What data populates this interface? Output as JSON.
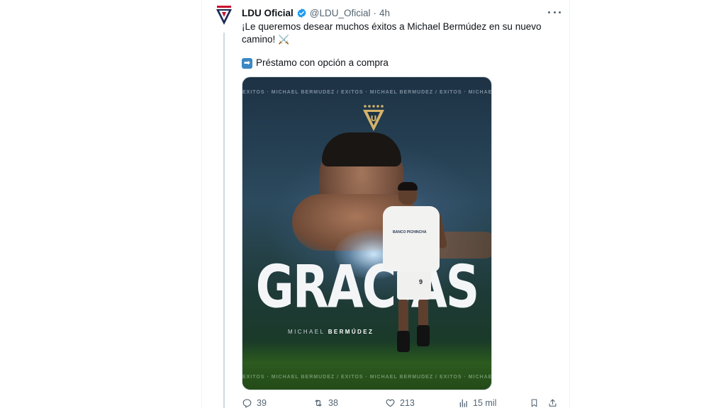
{
  "tweet": {
    "author_name": "LDU Oficial",
    "handle": "@LDU_Oficial",
    "separator": "·",
    "time": "4h",
    "text_main": "¡Le queremos desear muchos éxitos a Michael Bermúdez en su nuevo camino!",
    "text_emoji": "⚔️",
    "line2_emoji": "➡",
    "line2_text": "Préstamo con opción a compra"
  },
  "media": {
    "ticker_top": "ÉXITOS · MICHAEL BERMÚDEZ / ÉXITOS · MICHAEL BERMÚDEZ / ÉXITOS · MICHAEL BE",
    "ticker_bottom": "ÉXITOS · MICHAEL BERMÚDEZ / ÉXITOS · MICHAEL BERMÚDEZ / ÉXITOS · MICHAEL BE",
    "headline": "GRACIAS",
    "subtitle_first": "MICHAEL",
    "subtitle_last": "BERMÚDEZ",
    "jersey_sponsor": "BANCO PICHINCHA",
    "jersey_number": "9"
  },
  "actions": {
    "replies": "39",
    "reposts": "38",
    "likes": "213",
    "views": "15 mil"
  },
  "colors": {
    "verified": "#1d9bf0",
    "text_secondary": "#536471",
    "thread_line": "#cfd9de"
  },
  "icons": [
    "verified-badge-icon",
    "more-icon",
    "reply-icon",
    "repost-icon",
    "like-icon",
    "views-icon",
    "bookmark-icon",
    "share-icon"
  ]
}
